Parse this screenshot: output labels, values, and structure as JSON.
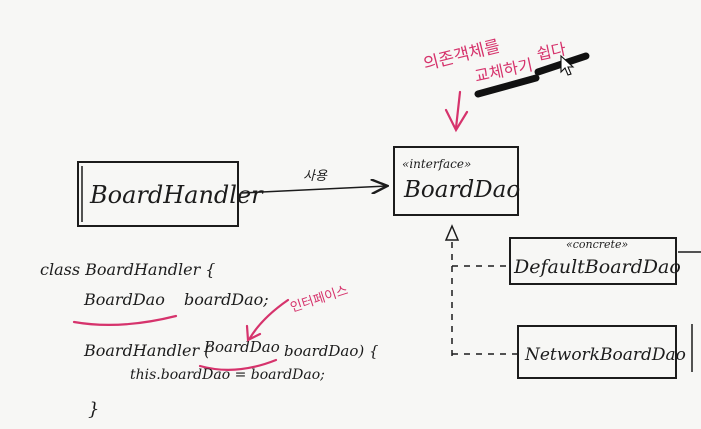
{
  "classes": {
    "board_handler": "BoardHandler",
    "board_dao": "BoardDao",
    "board_dao_stereotype": "«interface»",
    "default_board_dao": "DefaultBoardDao",
    "default_board_dao_stereotype": "«concrete»",
    "network_board_dao": "NetworkBoardDao"
  },
  "relations": {
    "use_label": "사용"
  },
  "annotations": {
    "top_line1": "의존객체를",
    "top_line2": "교체하기",
    "top_line3": "쉽다",
    "interface_note": "인터페이스"
  },
  "code": {
    "line1": "class BoardHandler {",
    "line2_type": "BoardDao",
    "line2_rest": "boardDao;",
    "line3_start": "BoardHandler (",
    "line3_type": "BoardDao",
    "line3_rest": "boardDao) {",
    "line4": "this.boardDao = boardDao;",
    "line5": "}"
  },
  "colors": {
    "ink": "#1c1c1c",
    "accent": "#d6336c",
    "background": "#f7f7f5"
  }
}
